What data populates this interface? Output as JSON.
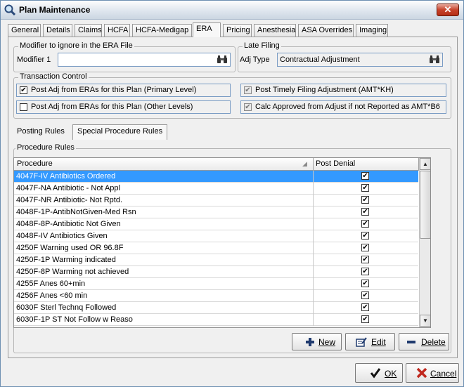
{
  "window": {
    "title": "Plan Maintenance",
    "close_glyph": "✕"
  },
  "tabs": [
    "General",
    "Details",
    "Claims",
    "HCFA",
    "HCFA-Medigap",
    "ERA",
    "Pricing",
    "Anesthesia",
    "ASA Overrides",
    "Imaging"
  ],
  "active_tab": "ERA",
  "modifier_group": {
    "legend": "Modifier to ignore in the ERA File",
    "field_label": "Modifier 1",
    "value": ""
  },
  "late_filing": {
    "legend": "Late Filing",
    "field_label": "Adj Type",
    "value": "Contractual Adjustment"
  },
  "transaction_control": {
    "legend": "Transaction Control",
    "options": [
      {
        "label": "Post Adj from ERAs for this Plan (Primary Level)",
        "checked": true,
        "disabled": false
      },
      {
        "label": "Post Adj from ERAs for this Plan (Other Levels)",
        "checked": false,
        "disabled": false
      },
      {
        "label": "Post Timely Filing Adjustment (AMT*KH)",
        "checked": true,
        "disabled": true
      },
      {
        "label": "Calc Approved from Adjust if not Reported as AMT*B6",
        "checked": true,
        "disabled": true
      }
    ]
  },
  "subtabs": {
    "posting": "Posting Rules",
    "special": "Special Procedure Rules"
  },
  "procedure_rules": {
    "legend": "Procedure Rules",
    "columns": {
      "procedure": "Procedure",
      "post_denial": "Post Denial"
    },
    "rows": [
      {
        "procedure": "4047F-IV Antibiotics Ordered",
        "post_denial": true
      },
      {
        "procedure": "4047F-NA Antibiotic - Not Appl",
        "post_denial": true
      },
      {
        "procedure": "4047F-NR Antibiotic- Not Rptd.",
        "post_denial": true
      },
      {
        "procedure": "4048F-1P-AntibNotGiven-Med Rsn",
        "post_denial": true
      },
      {
        "procedure": "4048F-8P-Antibiotic Not Given",
        "post_denial": true
      },
      {
        "procedure": "4048F-IV Antibiotics Given",
        "post_denial": true
      },
      {
        "procedure": "4250F Warning used OR 96.8F",
        "post_denial": true
      },
      {
        "procedure": "4250F-1P Warming indicated",
        "post_denial": true
      },
      {
        "procedure": "4250F-8P Warming not achieved",
        "post_denial": true
      },
      {
        "procedure": "4255F Anes 60+min",
        "post_denial": true
      },
      {
        "procedure": "4256F Anes <60 min",
        "post_denial": true
      },
      {
        "procedure": "6030F Sterl Technq Followed",
        "post_denial": true
      },
      {
        "procedure": "6030F-1P ST Not Follow w Reaso",
        "post_denial": true
      }
    ],
    "selected_index": 0
  },
  "actions": {
    "new": "New",
    "edit": "Edit",
    "delete": "Delete"
  },
  "dialog": {
    "ok": "OK",
    "cancel": "Cancel"
  },
  "colors": {
    "selection": "#3399ff",
    "cancel_icon": "#c0281e",
    "ok_icon": "#111111"
  },
  "icons": {
    "lookup": "binoculars-icon",
    "new": "plus-icon",
    "edit": "edit-icon",
    "delete": "minus-icon",
    "ok": "checkmark-icon",
    "cancel": "x-icon",
    "app": "magnifier-icon"
  }
}
